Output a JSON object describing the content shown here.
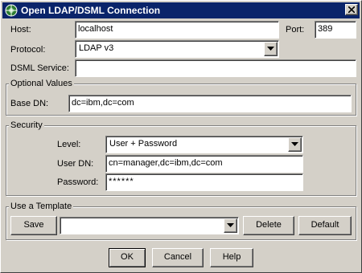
{
  "window": {
    "title": "Open LDAP/DSML Connection",
    "title_bar_color": "#0a246a"
  },
  "connection": {
    "host_label": "Host:",
    "host_value": "localhost",
    "port_label": "Port:",
    "port_value": "389",
    "protocol_label": "Protocol:",
    "protocol_value": "LDAP v3",
    "dsml_label": "DSML Service:",
    "dsml_value": ""
  },
  "optional_values": {
    "group_label": "Optional Values",
    "base_dn_label": "Base DN:",
    "base_dn_value": "dc=ibm,dc=com"
  },
  "security": {
    "group_label": "Security",
    "level_label": "Level:",
    "level_value": "User + Password",
    "user_dn_label": "User DN:",
    "user_dn_value": "cn=manager,dc=ibm,dc=com",
    "password_label": "Password:",
    "password_value": "******"
  },
  "template": {
    "group_label": "Use a Template",
    "save_label": "Save",
    "selected_value": "",
    "delete_label": "Delete",
    "default_label": "Default"
  },
  "footer": {
    "ok_label": "OK",
    "cancel_label": "Cancel",
    "help_label": "Help"
  },
  "icons": {
    "app": "ldap-app-icon",
    "close": "close-icon",
    "dropdown": "chevron-down-icon"
  }
}
